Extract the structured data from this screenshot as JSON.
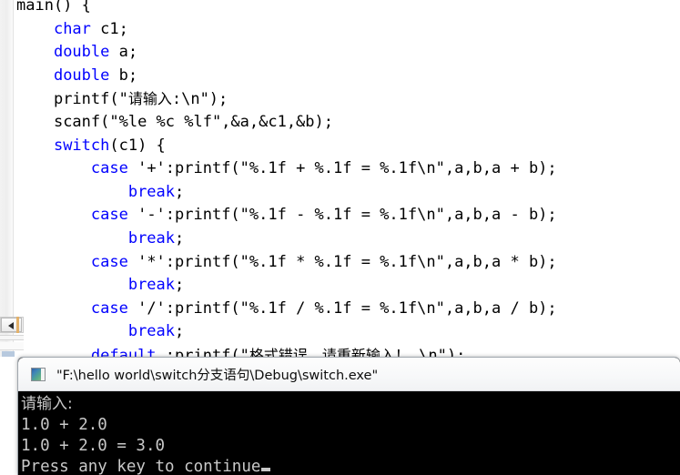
{
  "editor": {
    "name": "code-editor",
    "language": "C",
    "code_lines": [
      {
        "indent": 0,
        "segments": [
          {
            "t": "main() {",
            "c": "plain"
          }
        ]
      },
      {
        "indent": 1,
        "segments": [
          {
            "t": "char",
            "c": "kw"
          },
          {
            "t": " c1;",
            "c": "plain"
          }
        ]
      },
      {
        "indent": 1,
        "segments": [
          {
            "t": "double",
            "c": "kw"
          },
          {
            "t": " a;",
            "c": "plain"
          }
        ]
      },
      {
        "indent": 1,
        "segments": [
          {
            "t": "double",
            "c": "kw"
          },
          {
            "t": " b;",
            "c": "plain"
          }
        ]
      },
      {
        "indent": 1,
        "segments": [
          {
            "t": "printf(\"",
            "c": "plain"
          },
          {
            "t": "请输入",
            "c": "cjk"
          },
          {
            "t": ":\\n\");",
            "c": "plain"
          }
        ]
      },
      {
        "indent": 1,
        "segments": [
          {
            "t": "scanf(\"%le %c %lf\",&a,&c1,&b);",
            "c": "plain"
          }
        ]
      },
      {
        "indent": 1,
        "segments": [
          {
            "t": "switch",
            "c": "kw"
          },
          {
            "t": "(c1) {",
            "c": "plain"
          }
        ]
      },
      {
        "indent": 2,
        "segments": [
          {
            "t": "case",
            "c": "kw"
          },
          {
            "t": " '+':printf(\"%.1f + %.1f = %.1f\\n\",a,b,a + b);",
            "c": "plain"
          }
        ]
      },
      {
        "indent": 3,
        "segments": [
          {
            "t": "break",
            "c": "kw"
          },
          {
            "t": ";",
            "c": "plain"
          }
        ]
      },
      {
        "indent": 2,
        "segments": [
          {
            "t": "case",
            "c": "kw"
          },
          {
            "t": " '-':printf(\"%.1f - %.1f = %.1f\\n\",a,b,a - b);",
            "c": "plain"
          }
        ]
      },
      {
        "indent": 3,
        "segments": [
          {
            "t": "break",
            "c": "kw"
          },
          {
            "t": ";",
            "c": "plain"
          }
        ]
      },
      {
        "indent": 2,
        "segments": [
          {
            "t": "case",
            "c": "kw"
          },
          {
            "t": " '*':printf(\"%.1f * %.1f = %.1f\\n\",a,b,a * b);",
            "c": "plain"
          }
        ]
      },
      {
        "indent": 3,
        "segments": [
          {
            "t": "break",
            "c": "kw"
          },
          {
            "t": ";",
            "c": "plain"
          }
        ]
      },
      {
        "indent": 2,
        "segments": [
          {
            "t": "case",
            "c": "kw"
          },
          {
            "t": " '/':printf(\"%.1f / %.1f = %.1f\\n\",a,b,a / b);",
            "c": "plain"
          }
        ]
      },
      {
        "indent": 3,
        "segments": [
          {
            "t": "break",
            "c": "kw"
          },
          {
            "t": ";",
            "c": "plain"
          }
        ]
      },
      {
        "indent": 2,
        "segments": [
          {
            "t": "default",
            "c": "kw"
          },
          {
            "t": " :printf(\"",
            "c": "plain"
          },
          {
            "t": "格式错误，请重新输入！",
            "c": "cjk"
          },
          {
            "t": " \\n\");",
            "c": "plain"
          }
        ]
      }
    ],
    "colors": {
      "keyword": "#0000ff",
      "plain": "#000000",
      "background": "#ffffff",
      "gutter": "#f0f0f0"
    }
  },
  "scrollbar": {
    "name": "horizontal-scrollbar",
    "left_arrow_glyph": "◀"
  },
  "console": {
    "name": "console-window",
    "title": "\"F:\\hello world\\switch分支语句\\Debug\\switch.exe\"",
    "icon": "console-app-icon",
    "background": "#000000",
    "text_color": "#c8c8c8",
    "output_lines": [
      "请输入:",
      "1.0 + 2.0",
      "1.0 + 2.0 = 3.0",
      "Press any key to continue"
    ],
    "cursor_visible": true
  }
}
